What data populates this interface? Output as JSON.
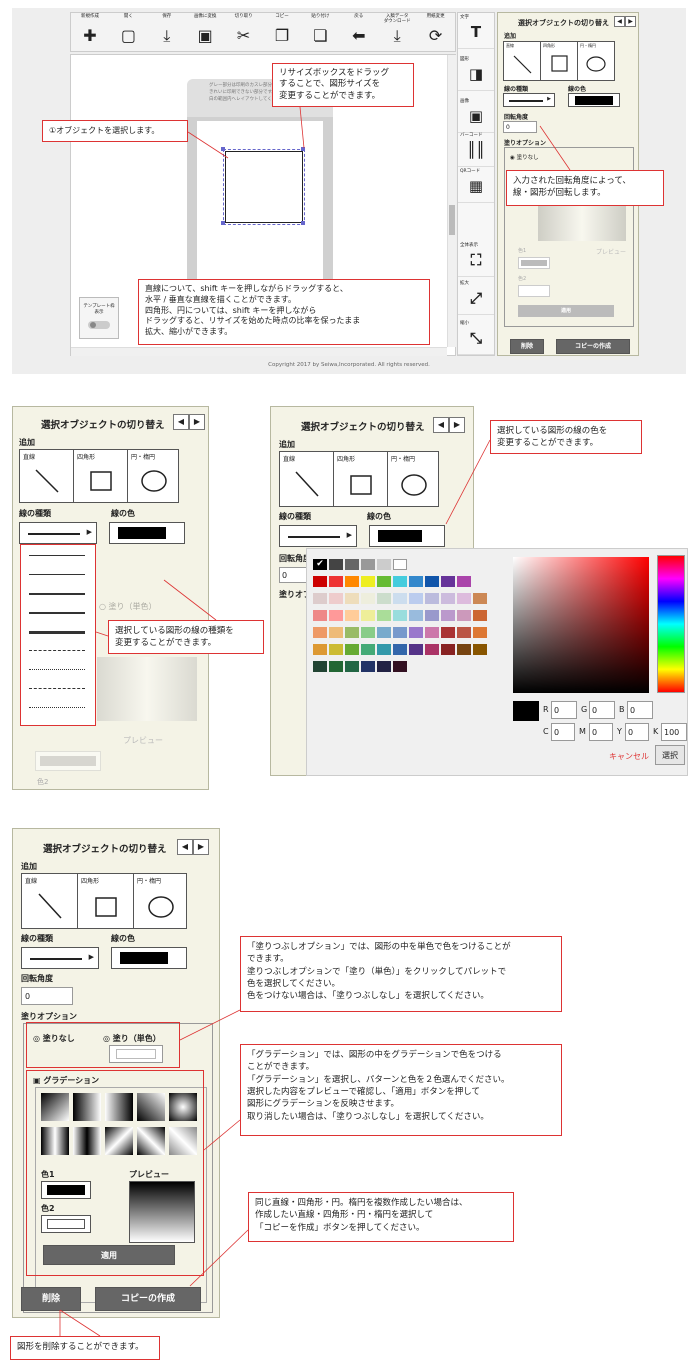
{
  "colors": {
    "accent": "#d33333",
    "panel": "#f4f3e6",
    "toolbar": "#f3f3f3",
    "dark_button": "#666666"
  },
  "editor": {
    "toolbar": [
      {
        "label": "新規作成",
        "icon": "new-icon"
      },
      {
        "label": "開く",
        "icon": "open-icon"
      },
      {
        "label": "保存",
        "icon": "save-icon"
      },
      {
        "label": "画像に変換",
        "icon": "image-icon"
      },
      {
        "label": "切り取り",
        "icon": "scissors-icon"
      },
      {
        "label": "コピー",
        "icon": "copy-icon"
      },
      {
        "label": "貼り付け",
        "icon": "paste-icon"
      },
      {
        "label": "戻る",
        "icon": "back-arrow-icon"
      },
      {
        "label": "入稿データ\nダウンロード",
        "icon": "download-icon"
      },
      {
        "label": "用紙変更",
        "icon": "refresh-icon"
      }
    ],
    "canvas_hint": "グレー部分は印刷のカスレ部分や\nきれいに印刷できない部分です。\n白の範囲内へレイアウトしてください。",
    "template_toggle": "テンプレート枠\n表示",
    "side_tools": [
      {
        "label": "文字",
        "icon": "text-tool-icon"
      },
      {
        "label": "図形",
        "icon": "shape-tool-icon"
      },
      {
        "label": "画像",
        "icon": "image-tool-icon"
      },
      {
        "label": "バーコード",
        "icon": "barcode-icon"
      },
      {
        "label": "QRコード",
        "icon": "qrcode-icon"
      },
      {
        "label": "全体表示",
        "icon": "fit-screen-icon"
      },
      {
        "label": "拡大",
        "icon": "zoom-in-icon"
      },
      {
        "label": "縮小",
        "icon": "zoom-out-icon"
      }
    ],
    "footer": "Copyright 2017 by Seiwa,Incorporated. All rights reserved."
  },
  "panel": {
    "title": "選択オブジェクトの切り替え",
    "add": "追加",
    "shape_line": "直線",
    "shape_rect": "四角形",
    "shape_circle": "円・楕円",
    "line_type": "線の種類",
    "line_color": "線の色",
    "rotation": "回転角度",
    "rotation_value": "0",
    "fill_option": "塗りオプション",
    "fill_none": "塗りなし",
    "fill_solid": "塗り（単色）",
    "gradation": "グラデーション",
    "color1": "色1",
    "color2": "色2",
    "preview": "プレビュー",
    "apply": "適用",
    "delete": "削除",
    "copy_create": "コピーの作成"
  },
  "picker": {
    "r": "0",
    "g": "0",
    "b": "0",
    "c": "0",
    "m": "0",
    "y": "0",
    "k": "100",
    "r_label": "R",
    "g_label": "G",
    "b_label": "B",
    "c_label": "C",
    "m_label": "M",
    "y_label": "Y",
    "k_label": "K",
    "cancel": "キャンセル",
    "select": "選択"
  },
  "notes": {
    "select_object": "①オブジェクトを選択します。",
    "resize": "リサイズボックスをドラッグ\nすることで、図形サイズを\n変更することができます。",
    "rotation": "入力された回転角度によって、\n線・図形が回転します。",
    "shift": "直線について、shift キーを押しながらドラッグすると、\n水平 / 垂直な直線を描くことができます。\n四角形、円については、shift キーを押しながら\nドラッグすると、リサイズを始めた時点の比率を保ったまま\n拡大、縮小ができます。",
    "line_type": "選択している図形の線の種類を\n変更することができます。",
    "line_color": "選択している図形の線の色を\n変更することができます。",
    "fill": "「塗りつぶしオプション」では、図形の中を単色で色をつけることが\nできます。\n塗りつぶしオプションで「塗り（単色）」をクリックしてパレットで\n色を選択してください。\n色をつけない場合は、「塗りつぶしなし」を選択してください。",
    "gradation": "「グラデーション」では、図形の中をグラデーションで色をつける\nことができます。\n「グラデーション」を選択し、パターンと色を２色選んでください。\n選択した内容をプレビューで確認し、「適用」ボタンを押して\n図形にグラデーションを反映させます。\n取り消したい場合は、「塗りつぶしなし」を選択してください。",
    "copy": "同じ直線・四角形・円。楕円を複数作成したい場合は、\n作成したい直線・四角形・円・楕円を選択して\n「コピーを作成」ボタンを押してください。",
    "delete": "図形を削除することができます。"
  }
}
